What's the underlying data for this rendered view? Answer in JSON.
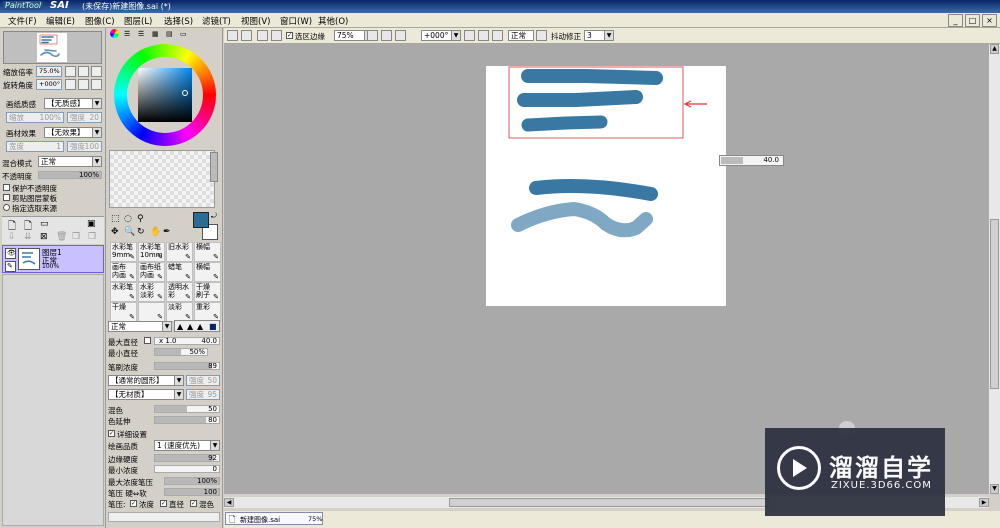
{
  "window": {
    "logo_text": "PaintTool",
    "app_name": "SAI",
    "title": "(未保存)新建图像.sai (*)",
    "minimize": "_",
    "maximize": "□",
    "close": "×"
  },
  "menu": [
    "文件(F)",
    "编辑(E)",
    "图像(C)",
    "图层(L)",
    "选择(S)",
    "滤镜(T)",
    "视图(V)",
    "窗口(W)",
    "其他(O)"
  ],
  "navigator": {
    "zoom_label": "缩放倍率",
    "zoom_value": "75.0%",
    "rotate_label": "旋转角度",
    "rotate_value": "+000°"
  },
  "layer_props": {
    "paper_texture_label": "画纸质感",
    "paper_texture_value": "【无质感】",
    "texture_scale_label": "缩放",
    "texture_scale_value": "100%",
    "texture_strength_label": "强度",
    "texture_strength_value": "20",
    "paper_effect_label": "画材效果",
    "paper_effect_value": "【无效果】",
    "effect_width_label": "宽度",
    "effect_width_value": "1",
    "effect_strength_label": "强度",
    "effect_strength_value": "100",
    "blend_mode_label": "混合模式",
    "blend_mode_value": "正常",
    "opacity_label": "不透明度",
    "opacity_value": "100%",
    "opacity_fraction": 1.0,
    "protect_opacity": "保护不透明度",
    "clipping": "剪贴图层蒙板",
    "selection_source": "指定选取来源"
  },
  "layers": [
    {
      "name": "图层1",
      "mode": "正常",
      "opacity": "100%"
    }
  ],
  "toolbar": {
    "selection_edge": "选区边缘",
    "zoom": "75%",
    "rotation": "+000°",
    "blend": "正常",
    "stabilizer_label": "抖动修正",
    "stabilizer_value": "3"
  },
  "tools": [
    [
      "水彩笔",
      "水彩笔",
      "旧水彩",
      "横幅"
    ],
    [
      "画布",
      "画布纸",
      "蜡笔",
      "横幅"
    ],
    [
      "水彩笔",
      "水彩",
      "透明水彩",
      "干燥"
    ],
    [
      "干燥",
      "",
      "淡彩",
      "重彩"
    ]
  ],
  "tool_sizes": [
    [
      "9mm",
      "10mm",
      "",
      ""
    ],
    [
      "内画",
      "内画",
      "",
      ""
    ],
    [
      "",
      "淡彩",
      "",
      "刷子"
    ],
    [
      "",
      "",
      "",
      ""
    ]
  ],
  "brush": {
    "mode": "正常",
    "max_size_label": "最大直径",
    "max_size_mult": "x 1.0",
    "max_size_value": "40.0",
    "min_size_label": "最小直径",
    "min_size_value": "50%",
    "min_size_fraction": 0.5,
    "density_label": "笔刷浓度",
    "density_value": "89",
    "density_fraction": 0.89,
    "shape": "【通常的圆形】",
    "shape_strength": "强度",
    "shape_strength_value": "50",
    "texture": "【无材质】",
    "texture_strength": "强度",
    "texture_strength_value": "95",
    "blending_label": "混色",
    "blending_value": "50",
    "blending_fraction": 0.5,
    "dilution_label": "色延伸",
    "dilution_value": "80",
    "dilution_fraction": 0.8,
    "detail_label": "详细设置",
    "quality_label": "绘画品质",
    "quality_value": "1 (速度优先)",
    "edge_hardness_label": "边缘硬度",
    "edge_hardness_value": "92",
    "edge_hardness_fraction": 0.92,
    "min_density_label": "最小浓度",
    "min_density_value": "0",
    "min_density_fraction": 0.0,
    "max_density_label": "最大浓度笔压",
    "max_density_value": "100%",
    "max_density_fraction": 1.0,
    "pressure_label": "笔压 硬⇔软",
    "pressure_value": "100",
    "pressure_fraction": 1.0,
    "pressure_targets_label": "笔压:",
    "pressure_density": "浓度",
    "pressure_size": "直径",
    "pressure_blend": "混色"
  },
  "canvas_tooltip": "40.0",
  "status": {
    "doc_name": "新建图像.sai",
    "doc_zoom": "75%"
  },
  "watermark": {
    "title": "溜溜自学",
    "url": "ZIXUE.3D66.COM"
  },
  "colors": {
    "stroke_dark": "#3a78a4",
    "stroke_light": "#7fa8c4",
    "primary": "#2b6c94",
    "highlight_rect": "#d33",
    "arrow": "#d33"
  }
}
